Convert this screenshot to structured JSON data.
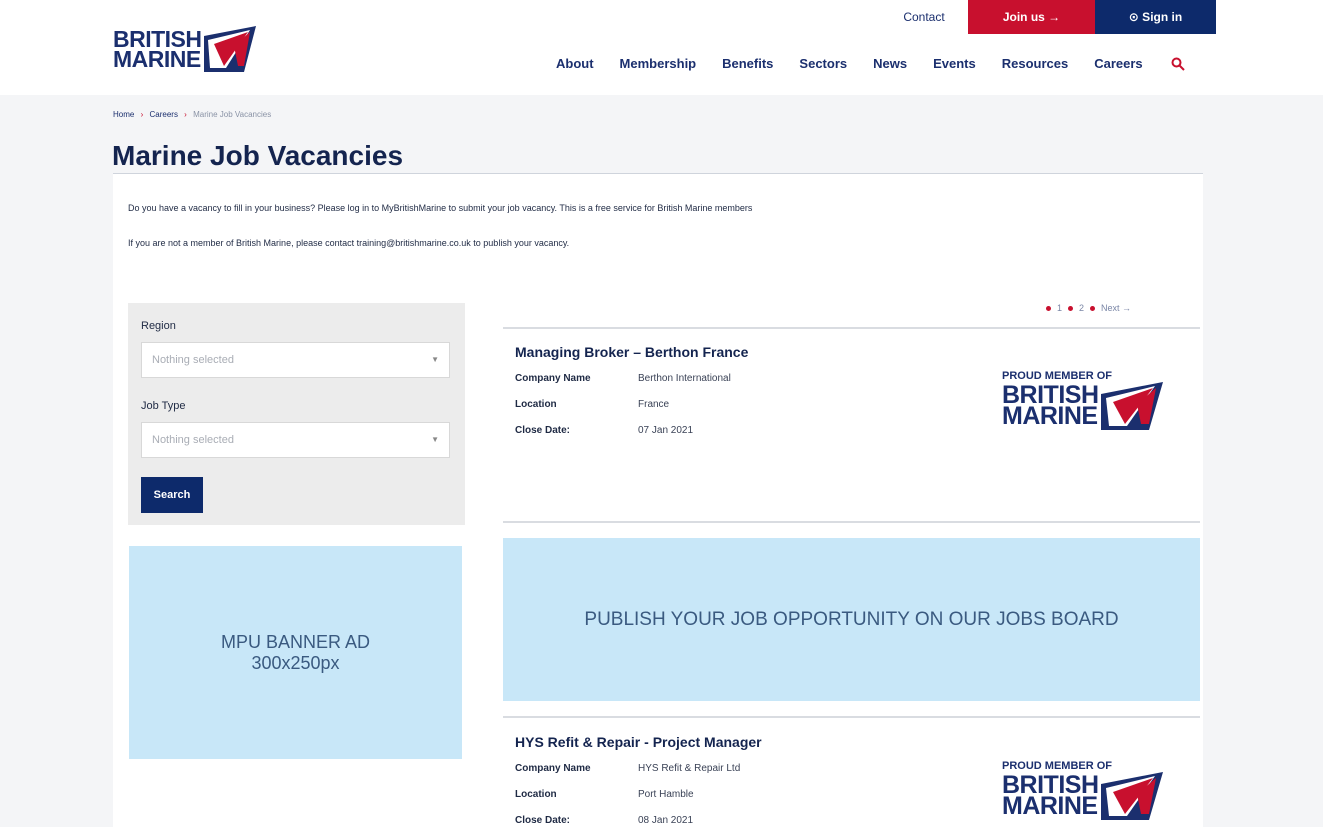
{
  "header": {
    "logo_line1": "BRITISH",
    "logo_line2": "MARINE",
    "contact_label": "Contact",
    "join_label": "Join us →",
    "signin_label": "⊙ Sign in",
    "nav": [
      "About",
      "Membership",
      "Benefits",
      "Sectors",
      "News",
      "Events",
      "Resources",
      "Careers"
    ],
    "search_icon": "search-icon"
  },
  "breadcrumb": {
    "home": "Home",
    "careers": "Careers",
    "current": "Marine Job Vacancies"
  },
  "page": {
    "title": "Marine Job Vacancies",
    "intro_1": "Do you have a vacancy to fill in your business? Please log in to MyBritishMarine to submit your job vacancy. This is a free service for British Marine members",
    "intro_2": "If you are not a member of British Marine, please contact training@britishmarine.co.uk to publish your vacancy."
  },
  "filters": {
    "region_label": "Region",
    "region_placeholder": "Nothing selected",
    "jobtype_label": "Job Type",
    "jobtype_placeholder": "Nothing selected",
    "search_label": "Search"
  },
  "ads": {
    "mpu_line1": "MPU BANNER AD",
    "mpu_line2": "300x250px",
    "jobs_board": "PUBLISH YOUR JOB OPPORTUNITY ON OUR JOBS BOARD"
  },
  "pagination": {
    "pages": [
      "1",
      "2"
    ],
    "next_label": "Next →"
  },
  "jobs": [
    {
      "title": "Managing Broker – Berthon France",
      "company_label": "Company Name",
      "company": "Berthon International",
      "location_label": "Location",
      "location": "France",
      "close_label": "Close Date:",
      "close_date": "07 Jan 2021",
      "badge_top": "PROUD MEMBER OF",
      "badge_line1": "BRITISH",
      "badge_line2": "MARINE"
    },
    {
      "title": "HYS Refit & Repair - Project Manager",
      "company_label": "Company Name",
      "company": "HYS Refit & Repair Ltd",
      "location_label": "Location",
      "location": "Port Hamble",
      "close_label": "Close Date:",
      "close_date": "08 Jan 2021",
      "badge_top": "PROUD MEMBER OF",
      "badge_line1": "BRITISH",
      "badge_line2": "MARINE"
    }
  ],
  "colors": {
    "brand_navy": "#0d2a6b",
    "brand_red": "#c8102e",
    "ad_blue": "#c8e7f8"
  }
}
